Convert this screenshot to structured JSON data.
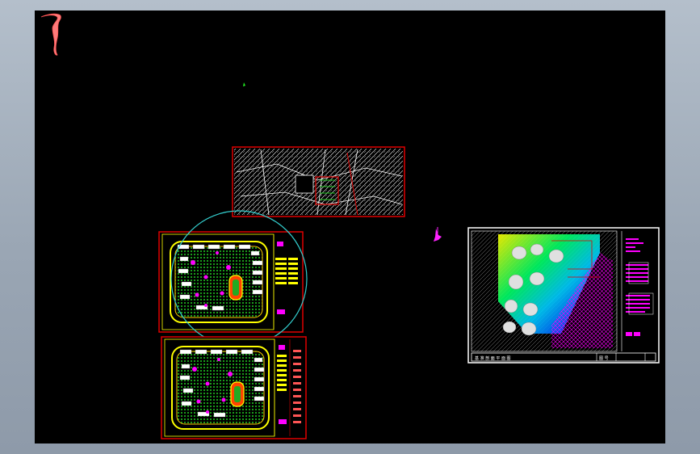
{
  "title_block": {
    "caption": "基 准 剖 面 平 面 图",
    "stamp": "图 号"
  },
  "colors": {
    "background": "#000000",
    "frame": "#ffffff",
    "red_frame": "#e00000",
    "yellow": "#ffff00",
    "green": "#22cc22",
    "magenta": "#ff00ff",
    "cyan": "#33cccc",
    "pink": "#ff6e6e"
  },
  "icons": {
    "river": "river-stroke-icon",
    "marker_green": "green-dot-icon",
    "marker_magenta": "magenta-symbol-icon"
  }
}
